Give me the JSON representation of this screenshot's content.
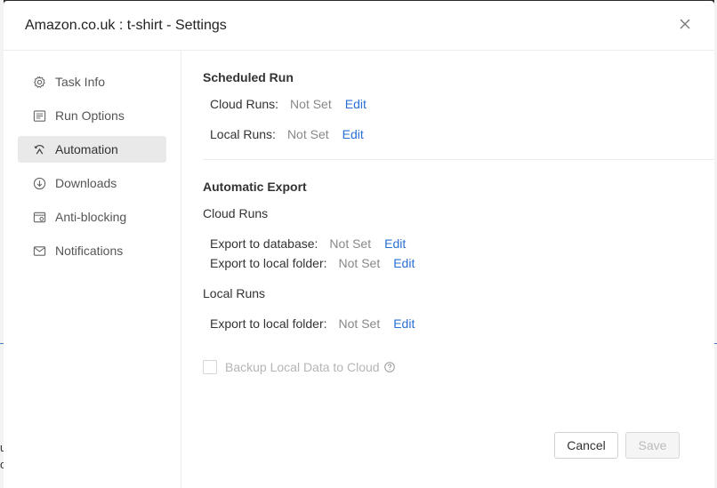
{
  "dialog": {
    "title": "Amazon.co.uk : t-shirt - Settings",
    "close_icon": "close-icon"
  },
  "sidebar": {
    "items": [
      {
        "label": "Task Info",
        "icon": "gear-icon",
        "active": false
      },
      {
        "label": "Run Options",
        "icon": "list-icon",
        "active": false
      },
      {
        "label": "Automation",
        "icon": "automation-icon",
        "active": true
      },
      {
        "label": "Downloads",
        "icon": "download-icon",
        "active": false
      },
      {
        "label": "Anti-blocking",
        "icon": "anti-blocking-icon",
        "active": false
      },
      {
        "label": "Notifications",
        "icon": "mail-icon",
        "active": false
      }
    ]
  },
  "scheduled_run": {
    "title": "Scheduled Run",
    "cloud": {
      "label": "Cloud Runs:",
      "value": "Not Set",
      "edit": "Edit"
    },
    "local": {
      "label": "Local Runs:",
      "value": "Not Set",
      "edit": "Edit"
    }
  },
  "automatic_export": {
    "title": "Automatic Export",
    "cloud_runs": {
      "title": "Cloud Runs",
      "database": {
        "label": "Export to database:",
        "value": "Not Set",
        "edit": "Edit"
      },
      "local_folder": {
        "label": "Export to local folder:",
        "value": "Not Set",
        "edit": "Edit"
      }
    },
    "local_runs": {
      "title": "Local Runs",
      "local_folder": {
        "label": "Export to local folder:",
        "value": "Not Set",
        "edit": "Edit"
      }
    }
  },
  "backup": {
    "label": "Backup Local Data to Cloud",
    "checked": false
  },
  "footer": {
    "cancel": "Cancel",
    "save": "Save"
  },
  "background": {
    "char1": "u",
    "char2": "o"
  },
  "colors": {
    "link": "#2a6fd6",
    "active_bg": "#e9e9e9"
  }
}
